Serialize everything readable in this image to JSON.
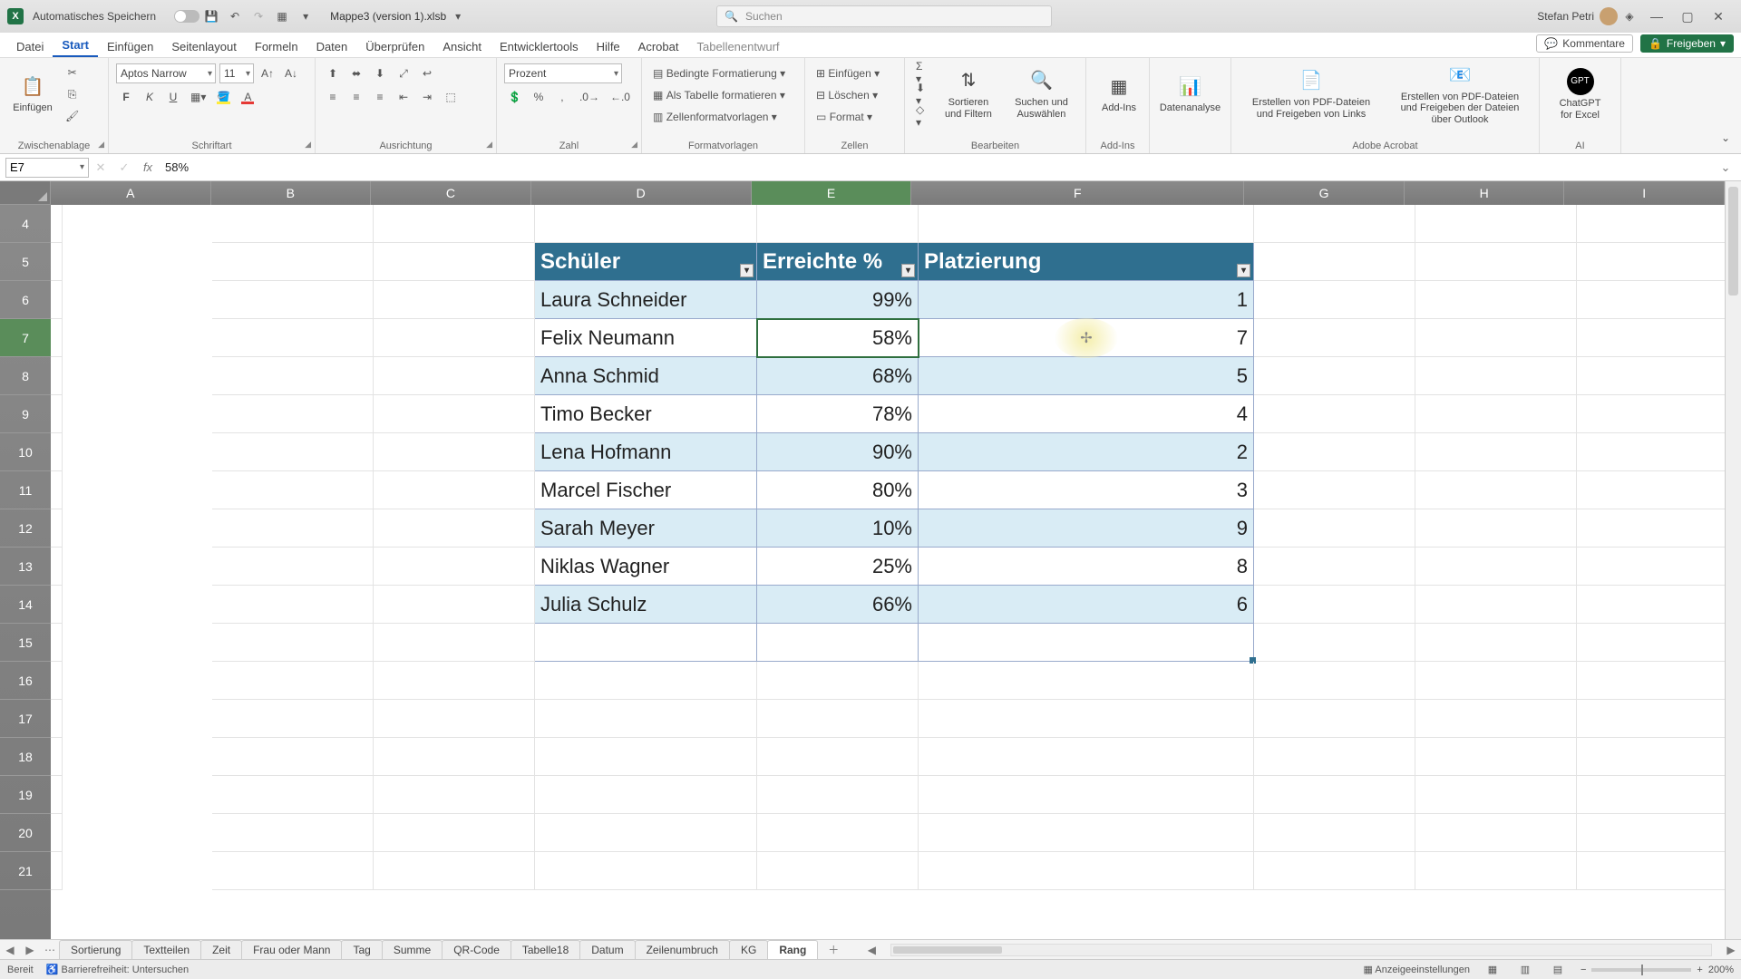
{
  "title": {
    "autosave": "Automatisches Speichern",
    "doc": "Mappe3 (version 1).xlsb",
    "search_placeholder": "Suchen",
    "user": "Stefan Petri"
  },
  "menus": [
    "Datei",
    "Start",
    "Einfügen",
    "Seitenlayout",
    "Formeln",
    "Daten",
    "Überprüfen",
    "Ansicht",
    "Entwicklertools",
    "Hilfe",
    "Acrobat",
    "Tabellenentwurf"
  ],
  "menu_active": "Start",
  "menu_context": "Tabellenentwurf",
  "menu_right": {
    "comments": "Kommentare",
    "share": "Freigeben"
  },
  "ribbon": {
    "clipboard": {
      "paste": "Einfügen",
      "label": "Zwischenablage"
    },
    "font": {
      "name": "Aptos Narrow",
      "size": "11",
      "label": "Schriftart"
    },
    "align": {
      "label": "Ausrichtung"
    },
    "number": {
      "format": "Prozent",
      "label": "Zahl"
    },
    "styles": {
      "cond": "Bedingte Formatierung",
      "astable": "Als Tabelle formatieren",
      "cellstyles": "Zellenformatvorlagen",
      "label": "Formatvorlagen"
    },
    "cells": {
      "insert": "Einfügen",
      "delete": "Löschen",
      "format": "Format",
      "label": "Zellen"
    },
    "editing": {
      "sort": "Sortieren und Filtern",
      "find": "Suchen und Auswählen",
      "label": "Bearbeiten"
    },
    "addins": {
      "addins": "Add-Ins",
      "label": "Add-Ins"
    },
    "analysis": {
      "btn": "Datenanalyse"
    },
    "acrobat": {
      "b1": "Erstellen von PDF-Dateien und Freigeben von Links",
      "b2": "Erstellen von PDF-Dateien und Freigeben der Dateien über Outlook",
      "label": "Adobe Acrobat"
    },
    "ai": {
      "btn": "ChatGPT for Excel",
      "label": "AI"
    }
  },
  "formula": {
    "cellref": "E7",
    "value": "58%"
  },
  "columns": [
    "A",
    "B",
    "C",
    "D",
    "E",
    "F",
    "G",
    "H",
    "I"
  ],
  "active_col": "E",
  "rows_start": 4,
  "rows": [
    "4",
    "5",
    "6",
    "7",
    "8",
    "9",
    "10",
    "11",
    "12",
    "13",
    "14",
    "15",
    "16",
    "17",
    "18",
    "19",
    "20",
    "21"
  ],
  "active_row": "7",
  "table": {
    "headers": [
      "Schüler",
      "Erreichte %",
      "Platzierung"
    ],
    "data": [
      {
        "s": "Laura Schneider",
        "p": "99%",
        "r": "1"
      },
      {
        "s": "Felix Neumann",
        "p": "58%",
        "r": "7"
      },
      {
        "s": "Anna Schmid",
        "p": "68%",
        "r": "5"
      },
      {
        "s": "Timo Becker",
        "p": "78%",
        "r": "4"
      },
      {
        "s": "Lena Hofmann",
        "p": "90%",
        "r": "2"
      },
      {
        "s": "Marcel Fischer",
        "p": "80%",
        "r": "3"
      },
      {
        "s": "Sarah Meyer",
        "p": "10%",
        "r": "9"
      },
      {
        "s": "Niklas Wagner",
        "p": "25%",
        "r": "8"
      },
      {
        "s": "Julia Schulz",
        "p": "66%",
        "r": "6"
      }
    ]
  },
  "sheets": [
    "Sortierung",
    "Textteilen",
    "Zeit",
    "Frau oder Mann",
    "Tag",
    "Summe",
    "QR-Code",
    "Tabelle18",
    "Datum",
    "Zeilenumbruch",
    "KG",
    "Rang"
  ],
  "sheet_active": "Rang",
  "status": {
    "ready": "Bereit",
    "access": "Barrierefreiheit: Untersuchen",
    "display": "Anzeigeeinstellungen",
    "zoom": "200%"
  }
}
